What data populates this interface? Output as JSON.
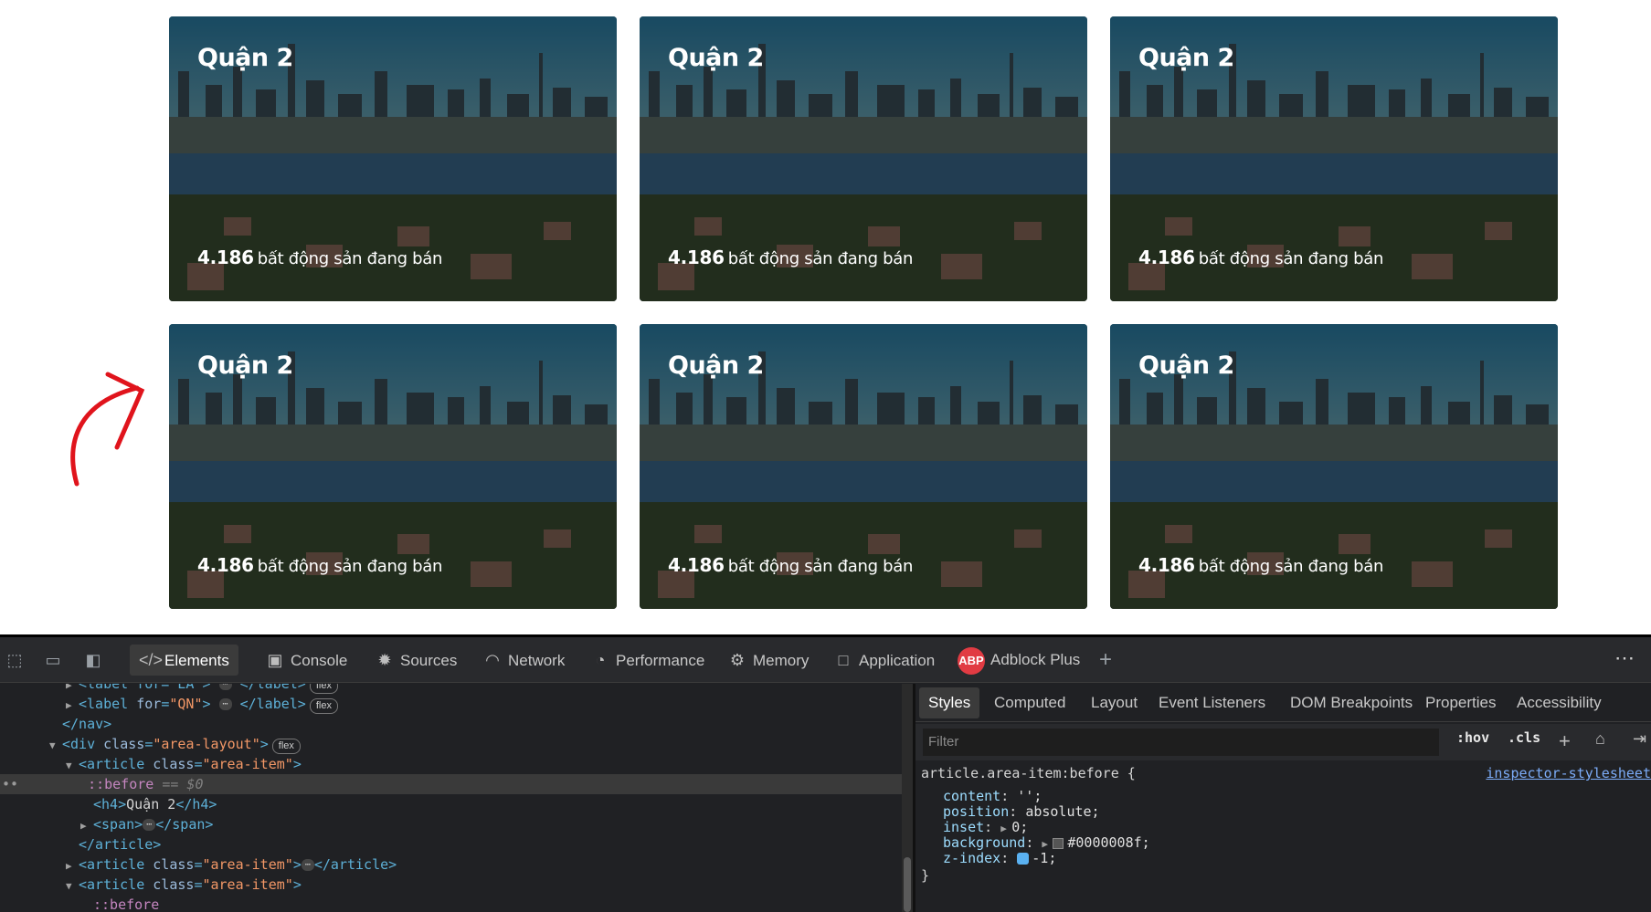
{
  "cards": [
    {
      "title": "Quận 2",
      "count": "4.186",
      "count_text": "bất động sản đang bán"
    },
    {
      "title": "Quận 2",
      "count": "4.186",
      "count_text": "bất động sản đang bán"
    },
    {
      "title": "Quận 2",
      "count": "4.186",
      "count_text": "bất động sản đang bán"
    },
    {
      "title": "Quận 2",
      "count": "4.186",
      "count_text": "bất động sản đang bán"
    },
    {
      "title": "Quận 2",
      "count": "4.186",
      "count_text": "bất động sản đang bán"
    },
    {
      "title": "Quận 2",
      "count": "4.186",
      "count_text": "bất động sản đang bán"
    }
  ],
  "devtools": {
    "tabs": [
      "Elements",
      "Console",
      "Sources",
      "Network",
      "Performance",
      "Memory",
      "Application",
      "Adblock Plus"
    ],
    "abp_badge": "ABP",
    "styles_tabs": [
      "Styles",
      "Computed",
      "Layout",
      "Event Listeners",
      "DOM Breakpoints",
      "Properties",
      "Accessibility"
    ],
    "filter_placeholder": "Filter",
    "hov": ":hov",
    "cls": ".cls",
    "rule": {
      "selector": "article.area-item:before {",
      "source": "inspector-stylesheet",
      "decls": [
        {
          "prop": "content",
          "value": "'';"
        },
        {
          "prop": "position",
          "value": "absolute;"
        },
        {
          "prop": "inset",
          "value": "0;"
        },
        {
          "prop": "background",
          "value": "#0000008f;"
        },
        {
          "prop": "z-index",
          "value": "-1;"
        }
      ],
      "close": "}"
    },
    "dom": {
      "label_ea": "label for=\"EA\"",
      "label_qn_for": "QN",
      "nav_close": "</nav>",
      "area_layout_class": "area-layout",
      "area_item_class": "area-item",
      "before": "::before",
      "before_ref": "== $0",
      "h4_text": "Quận 2",
      "article_close": "</article>",
      "flex_badge": "flex"
    }
  },
  "colors": {
    "annotation": "#e0141c",
    "accent": "#7cacf8"
  }
}
